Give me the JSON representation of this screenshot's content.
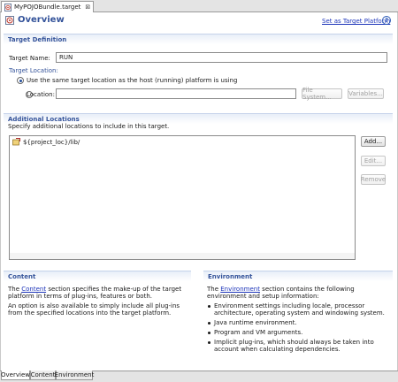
{
  "editor_tab": {
    "title": "MyPOJOBundle.target",
    "close": "⊠"
  },
  "header": {
    "title": "Overview",
    "set_target_link": "Set as Target Platform",
    "help": "?"
  },
  "target_definition": {
    "section_title": "Target Definition",
    "name_label": "Target Name:",
    "name_value": "RUN",
    "location_label": "Target Location:",
    "radio_same_host": "Use the same target location as the host (running) platform is using",
    "radio_location": "Location:",
    "location_value": "",
    "file_system_button": "File System...",
    "variables_button": "Variables..."
  },
  "additional_locations": {
    "section_title": "Additional Locations",
    "description": "Specify additional locations to include in this target.",
    "items": [
      "${project_loc}/lib/"
    ],
    "add_button": "Add...",
    "edit_button": "Edit...",
    "remove_button": "Remove"
  },
  "content_section": {
    "title": "Content",
    "p1_before": "The ",
    "p1_link": "Content",
    "p1_after": " section specifies the make-up of the target platform in terms of plug-ins, features or both.",
    "p2": "An option is also available to simply include all plug-ins from the specified locations into the target platform."
  },
  "environment_section": {
    "title": "Environment",
    "p1_before": "The ",
    "p1_link": "Environment",
    "p1_after": " section contains the following environment and setup information:",
    "bullets": [
      "Environment settings including locale, processor architecture, operating system and windowing system.",
      "Java runtime environment.",
      "Program and VM arguments.",
      "Implicit plug-ins, which should always be taken into account when calculating dependencies."
    ]
  },
  "page_tabs": [
    "Overview",
    "Content",
    "Environment"
  ]
}
